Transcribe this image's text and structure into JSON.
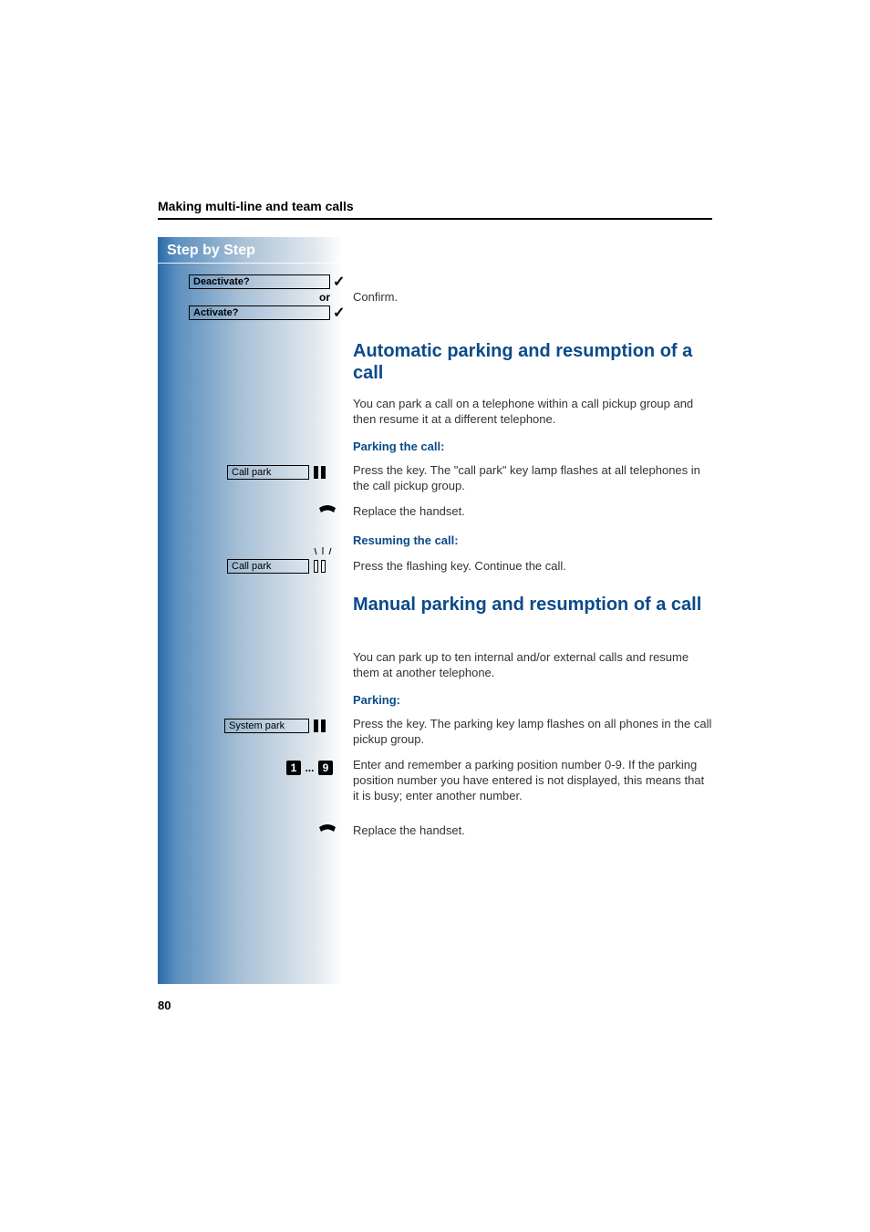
{
  "header": {
    "section_title": "Making multi-line and team calls"
  },
  "sidebar": {
    "title": "Step by Step",
    "menu": {
      "deactivate": "Deactivate?",
      "separator": "or",
      "activate": "Activate?"
    },
    "keys": {
      "call_park_1": "Call park",
      "call_park_2": "Call park",
      "system_park": "System park"
    },
    "digits": {
      "first": "1",
      "ellipsis": "...",
      "last": "9"
    }
  },
  "body": {
    "confirm": "Confirm.",
    "h2_auto": "Automatic parking and resumption of a call",
    "auto_intro": "You can park a call on a telephone within a call pickup group and then resume it at a different telephone.",
    "h4_parking_call": "Parking the call:",
    "auto_step1": "Press the key. The \"call park\" key lamp flashes at all telephones in the call pickup group.",
    "auto_step2": "Replace the handset.",
    "h4_resuming_call": "Resuming the call:",
    "auto_step3": "Press the flashing key. Continue the call.",
    "h2_manual": "Manual parking and resumption of a call",
    "manual_intro": "You can park up to ten internal and/or external calls and resume them at another telephone.",
    "h4_parking": "Parking:",
    "manual_step1": "Press the key. The parking key lamp flashes on all phones in the call pickup group.",
    "manual_step2": "Enter and remember a parking position number 0-9. If the parking position number you have entered is not displayed, this means that it is busy; enter another number.",
    "manual_step3": "Replace the handset."
  },
  "footer": {
    "page_number": "80"
  }
}
